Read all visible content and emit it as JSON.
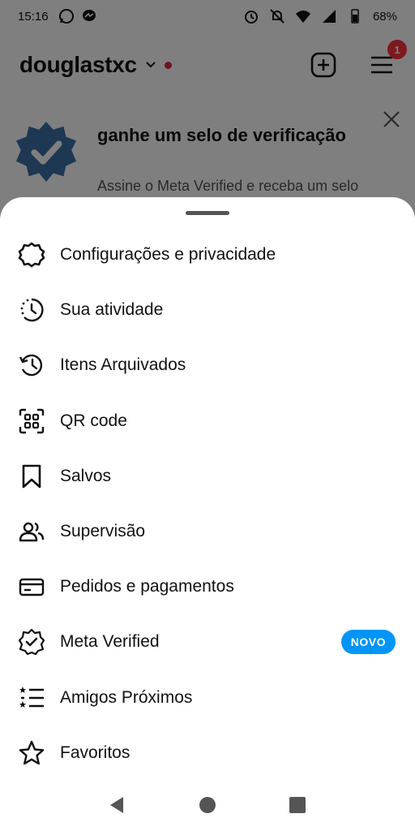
{
  "status_bar": {
    "time": "15:16",
    "battery": "68%",
    "left_icons": [
      "whatsapp-icon",
      "messenger-icon"
    ],
    "right_icons": [
      "alarm-icon",
      "mute-icon",
      "wifi-icon",
      "signal-icon",
      "battery-icon"
    ]
  },
  "header": {
    "username": "douglastxc",
    "notification_count": "1"
  },
  "promo": {
    "title": "ganhe um selo de verificação",
    "description": "Assine o Meta Verified e receba um selo"
  },
  "menu": {
    "items": [
      {
        "label": "Configurações e privacidade",
        "icon": "settings-icon"
      },
      {
        "label": "Sua atividade",
        "icon": "activity-icon"
      },
      {
        "label": "Itens Arquivados",
        "icon": "archive-icon"
      },
      {
        "label": "QR code",
        "icon": "qr-code-icon"
      },
      {
        "label": "Salvos",
        "icon": "bookmark-icon"
      },
      {
        "label": "Supervisão",
        "icon": "supervision-icon"
      },
      {
        "label": "Pedidos e pagamentos",
        "icon": "card-icon"
      },
      {
        "label": "Meta Verified",
        "icon": "verified-icon",
        "badge": "NOVO"
      },
      {
        "label": "Amigos Próximos",
        "icon": "close-friends-icon"
      },
      {
        "label": "Favoritos",
        "icon": "star-icon"
      }
    ]
  },
  "colors": {
    "accent": "#0095f6",
    "badge_red": "#ff3040",
    "verified_blue": "#3d6ea6"
  }
}
